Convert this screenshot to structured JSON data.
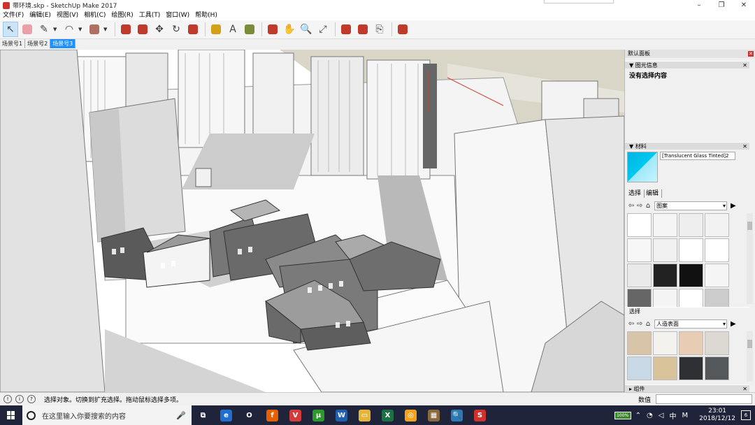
{
  "window": {
    "title": "带环境.skp - SketchUp Make 2017",
    "controls": [
      "–",
      "❐",
      "✕"
    ]
  },
  "menu": [
    "文件(F)",
    "编辑(E)",
    "视图(V)",
    "相机(C)",
    "绘图(R)",
    "工具(T)",
    "窗口(W)",
    "帮助(H)"
  ],
  "toolbar": {
    "tools": [
      {
        "name": "select-tool",
        "glyph": "↖",
        "active": true
      },
      {
        "name": "eraser-tool",
        "color": "#e9a0a8"
      },
      {
        "name": "pencil-tool",
        "glyph": "✎",
        "dropdown": true
      },
      {
        "name": "arc-tool",
        "glyph": "◠",
        "dropdown": true
      },
      {
        "name": "shape-tool",
        "color": "#b07060",
        "dropdown": true
      },
      {
        "name": "push-pull-tool",
        "color": "#c0392b"
      },
      {
        "name": "follow-me-tool",
        "color": "#c0392b"
      },
      {
        "name": "move-tool",
        "glyph": "✥"
      },
      {
        "name": "rotate-tool",
        "glyph": "↻"
      },
      {
        "name": "scale-tool",
        "color": "#c0392b"
      },
      {
        "name": "tape-measure-tool",
        "color": "#d4a017"
      },
      {
        "name": "text-tool",
        "glyph": "A"
      },
      {
        "name": "paint-bucket-tool",
        "color": "#7a8c3a"
      },
      {
        "name": "orbit-tool",
        "color": "#c0392b"
      },
      {
        "name": "pan-tool",
        "glyph": "✋"
      },
      {
        "name": "zoom-tool",
        "glyph": "🔍"
      },
      {
        "name": "zoom-extents-tool",
        "glyph": "⤢"
      },
      {
        "name": "3d-warehouse-tool",
        "color": "#c0392b"
      },
      {
        "name": "extension-warehouse-tool",
        "color": "#c0392b"
      },
      {
        "name": "send-to-layout-tool",
        "glyph": "⎘"
      },
      {
        "name": "ruby-console-tool",
        "color": "#c0392b"
      }
    ]
  },
  "scenes": [
    {
      "label": "场景号1",
      "selected": false
    },
    {
      "label": "场景号2",
      "selected": false
    },
    {
      "label": "场景号3",
      "selected": true
    }
  ],
  "tray": {
    "title": "默认面板",
    "entity_info": {
      "header": "▼ 图元信息",
      "content": "没有选择内容"
    },
    "materials": {
      "header": "▼ 材料",
      "current_name": "[Translucent Glass Tinted]2",
      "tabs": [
        "选择",
        "编辑"
      ],
      "library": "图案",
      "second_label": "选择",
      "second_library": "人造表面",
      "pattern_swatches": [
        "#ffffff",
        "#f5f5f5",
        "#eeeeee",
        "#f2f2f2",
        "#f7f7f7",
        "#f0f0f0",
        "#ffffff",
        "#ffffff",
        "#eaeaea",
        "#222222",
        "#111111",
        "#f5f5f5",
        "#666666",
        "#f4f4f4",
        "#ffffff",
        "#cccccc"
      ],
      "surface_swatches": [
        "#d8c4a8",
        "#f4f2ee",
        "#e8cdb4",
        "#dcd8d2",
        "#c8d8e4",
        "#d9c39a",
        "#2e3033",
        "#55585b"
      ]
    },
    "components": {
      "header": "▸ 组件"
    }
  },
  "status": {
    "message": "选择对象。切换到扩充选择。拖动鼠标选择多项。",
    "vcb_label": "数值",
    "icons": [
      "!",
      "i",
      "?"
    ]
  },
  "taskbar": {
    "search_placeholder": "在这里输入你要搜索的内容",
    "apps": [
      {
        "name": "task-view",
        "color": "#20243a",
        "glyph": "⧉"
      },
      {
        "name": "edge",
        "color": "#1f6fd0",
        "glyph": "e"
      },
      {
        "name": "opera",
        "color": "#20243a",
        "glyph": "O"
      },
      {
        "name": "firefox",
        "color": "#e66000",
        "glyph": "f"
      },
      {
        "name": "vivaldi",
        "color": "#d43b3b",
        "glyph": "V"
      },
      {
        "name": "utorrent",
        "color": "#2c9a2a",
        "glyph": "μ"
      },
      {
        "name": "wps",
        "color": "#1f5fb0",
        "glyph": "W"
      },
      {
        "name": "file-explorer",
        "color": "#e5b53a",
        "glyph": "▭"
      },
      {
        "name": "excel",
        "color": "#1e7145",
        "glyph": "X"
      },
      {
        "name": "chrome",
        "color": "#f2a31b",
        "glyph": "◎"
      },
      {
        "name": "photos",
        "color": "#8a6a3a",
        "glyph": "▦"
      },
      {
        "name": "search-app",
        "color": "#2a7ab8",
        "glyph": "🔍"
      },
      {
        "name": "sketchup",
        "color": "#d0312d",
        "glyph": "S"
      }
    ],
    "battery": "100%",
    "lang": "中",
    "ime": "M",
    "time": "23:01",
    "date": "2018/12/12",
    "notifications": "6"
  }
}
